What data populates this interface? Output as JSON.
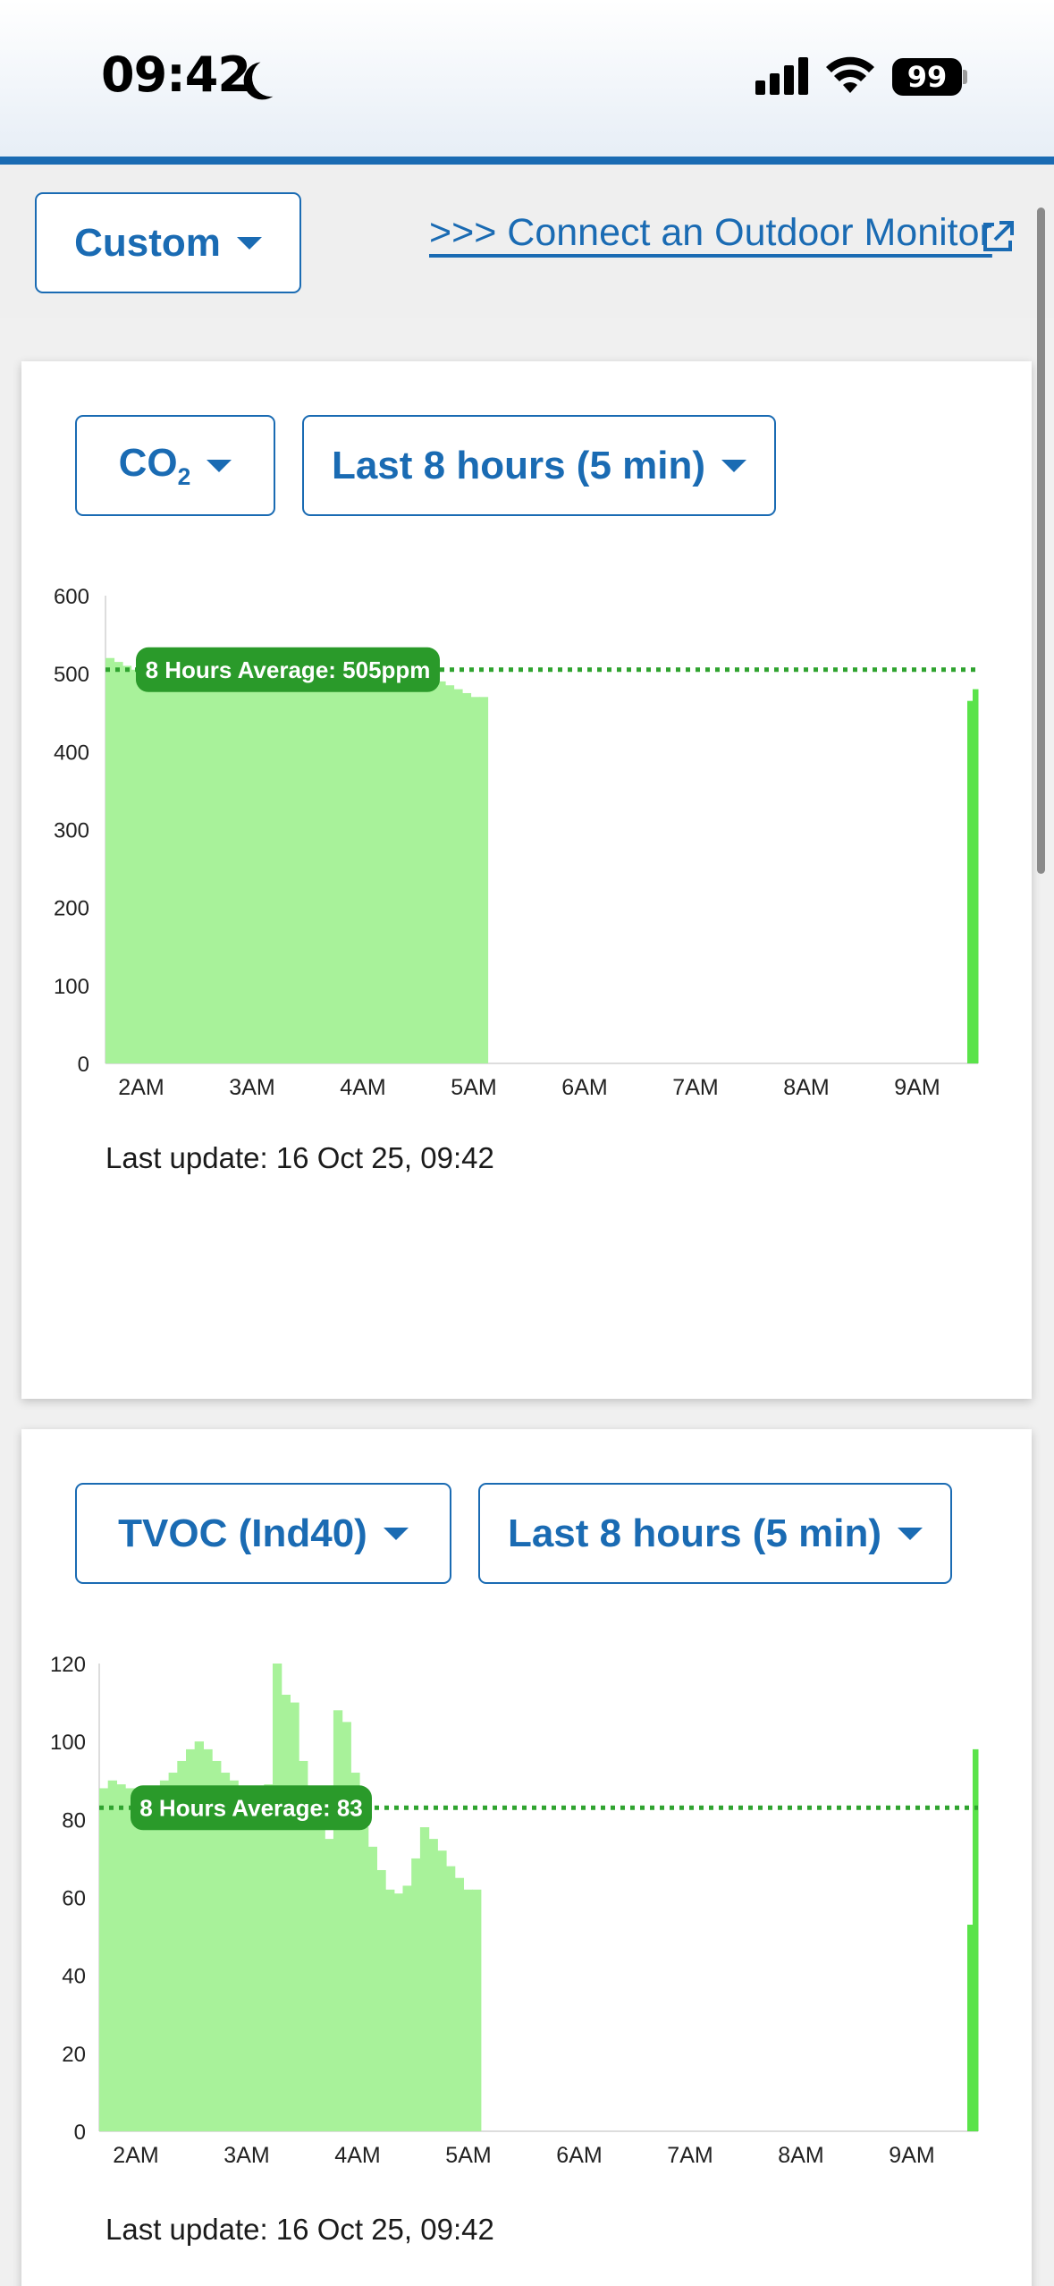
{
  "status_bar": {
    "time": "09:42",
    "battery": "99"
  },
  "topbar": {
    "range_label": "Custom",
    "outdoor_link": ">>> Connect an Outdoor Monitor"
  },
  "colors": {
    "accent": "#1a6bb3",
    "bar_light": "#a8f29a",
    "bar_current": "#5ae34a",
    "avg_line": "#2fa32f",
    "avg_badge": "#2a9a2a"
  },
  "icons": {
    "external": "external-link-icon",
    "caret": "caret-down-icon"
  },
  "charts": [
    {
      "metric_main": "CO",
      "metric_sub": "2",
      "period": "Last 8 hours (5 min)",
      "last_update": "Last update: 16 Oct 25, 09:42",
      "chart_data": {
        "type": "bar",
        "x_ticks": [
          "2AM",
          "3AM",
          "4AM",
          "5AM",
          "6AM",
          "7AM",
          "8AM",
          "9AM"
        ],
        "y_ticks": [
          0,
          100,
          200,
          300,
          400,
          500,
          600
        ],
        "ylim": [
          0,
          600
        ],
        "average": {
          "value": 505,
          "label": "8 Hours Average: 505ppm"
        },
        "values": [
          520,
          515,
          510,
          505,
          505,
          500,
          500,
          500,
          500,
          500,
          500,
          500,
          500,
          500,
          500,
          500,
          500,
          500,
          500,
          500,
          500,
          500,
          500,
          500,
          500,
          500,
          500,
          500,
          500,
          500,
          500,
          500,
          500,
          500,
          500,
          500,
          500,
          500,
          500,
          490,
          485,
          480,
          475,
          470,
          470
        ],
        "current_values": [
          465,
          480
        ]
      }
    },
    {
      "metric_main": "TVOC (Ind40)",
      "metric_sub": "",
      "period": "Last 8 hours (5 min)",
      "last_update": "Last update: 16 Oct 25, 09:42",
      "chart_data": {
        "type": "bar",
        "x_ticks": [
          "2AM",
          "3AM",
          "4AM",
          "5AM",
          "6AM",
          "7AM",
          "8AM",
          "9AM"
        ],
        "y_ticks": [
          0,
          20,
          40,
          60,
          80,
          100,
          120
        ],
        "ylim": [
          0,
          120
        ],
        "average": {
          "value": 83,
          "label": "8 Hours Average: 83"
        },
        "values": [
          88,
          90,
          89,
          88,
          88,
          87,
          88,
          90,
          92,
          95,
          98,
          100,
          98,
          95,
          92,
          90,
          88,
          86,
          87,
          89,
          120,
          112,
          110,
          95,
          85,
          80,
          75,
          108,
          105,
          92,
          78,
          73,
          67,
          62,
          61,
          63,
          70,
          78,
          75,
          72,
          68,
          65,
          62,
          62
        ],
        "current_values": [
          53,
          98
        ]
      }
    }
  ]
}
